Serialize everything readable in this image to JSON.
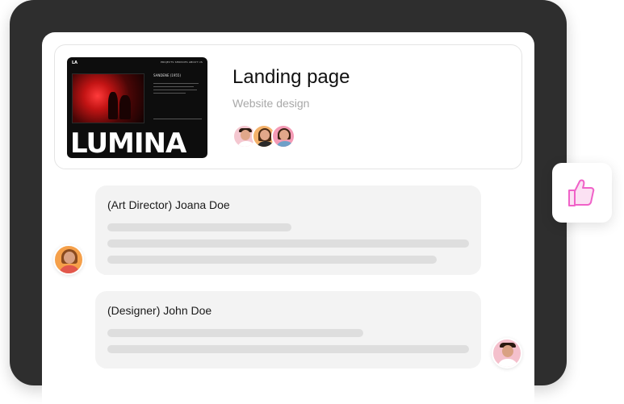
{
  "project": {
    "title": "Landing page",
    "subtitle": "Website design",
    "thumbnail": {
      "logo": "LA",
      "nav": "PROJECTS   SERVICES   ABOUT US",
      "meta_title": "SANDENE (1955)",
      "big_word": "LUMINA"
    },
    "team_avatars": [
      {
        "icon": "avatar-man-icon",
        "bg": "#f4c7d0"
      },
      {
        "icon": "avatar-woman-icon",
        "bg": "#f4b26b"
      },
      {
        "icon": "avatar-woman-icon",
        "bg": "#f49ab5"
      }
    ]
  },
  "comments": [
    {
      "author": "(Art Director) Joana Doe",
      "avatar_bg": "#f5a04a",
      "avatar_icon": "avatar-woman-icon"
    },
    {
      "author": "(Designer) John Doe",
      "avatar_bg": "#f4c0cc",
      "avatar_icon": "avatar-man-icon"
    }
  ],
  "reaction": {
    "icon": "thumbs-up-icon",
    "color": "#f062c8"
  },
  "colors": {
    "device_frame": "#2e2e2e",
    "comment_bg": "#f3f3f3",
    "skeleton": "#dedede",
    "accent_pink": "#f062c8"
  }
}
